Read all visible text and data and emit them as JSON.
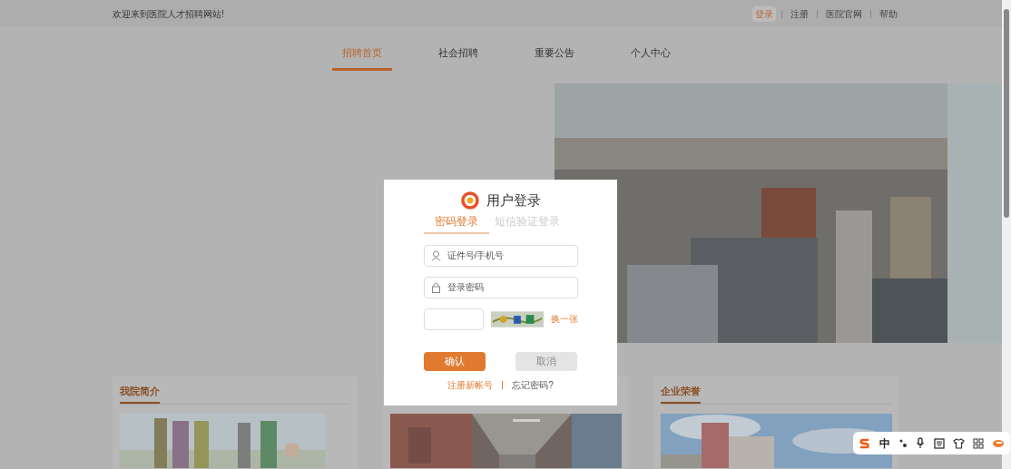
{
  "top_bar": {
    "welcome": "欢迎来到医院人才招聘网站!",
    "links": [
      {
        "label": "登录",
        "selected": true
      },
      {
        "label": "注册",
        "selected": false
      },
      {
        "label": "医院官网",
        "selected": false
      },
      {
        "label": "帮助",
        "selected": false
      }
    ]
  },
  "nav": [
    {
      "label": "招聘首页",
      "selected": true
    },
    {
      "label": "社会招聘",
      "selected": false
    },
    {
      "label": "重要公告",
      "selected": false
    },
    {
      "label": "个人中心",
      "selected": false
    }
  ],
  "cards": [
    {
      "kind": "titled",
      "title": "我院简介"
    },
    {
      "kind": "covered"
    },
    {
      "kind": "titled",
      "title": "企业荣誉"
    }
  ],
  "login": {
    "title": "用户登录",
    "tabs": [
      {
        "label": "密码登录",
        "selected": true
      },
      {
        "label": "短信验证登录",
        "selected": false
      }
    ],
    "fields": [
      {
        "kind": "user",
        "placeholder": "证件号/手机号"
      },
      {
        "kind": "lock",
        "placeholder": "登录密码"
      }
    ],
    "captcha_refresh": "换一张",
    "buttons": [
      {
        "label": "确认",
        "disabled": false
      },
      {
        "label": "取消",
        "disabled": true
      }
    ],
    "links": [
      "注册新帐号",
      "忘记密码?"
    ]
  },
  "ime": {
    "mode": "中"
  }
}
